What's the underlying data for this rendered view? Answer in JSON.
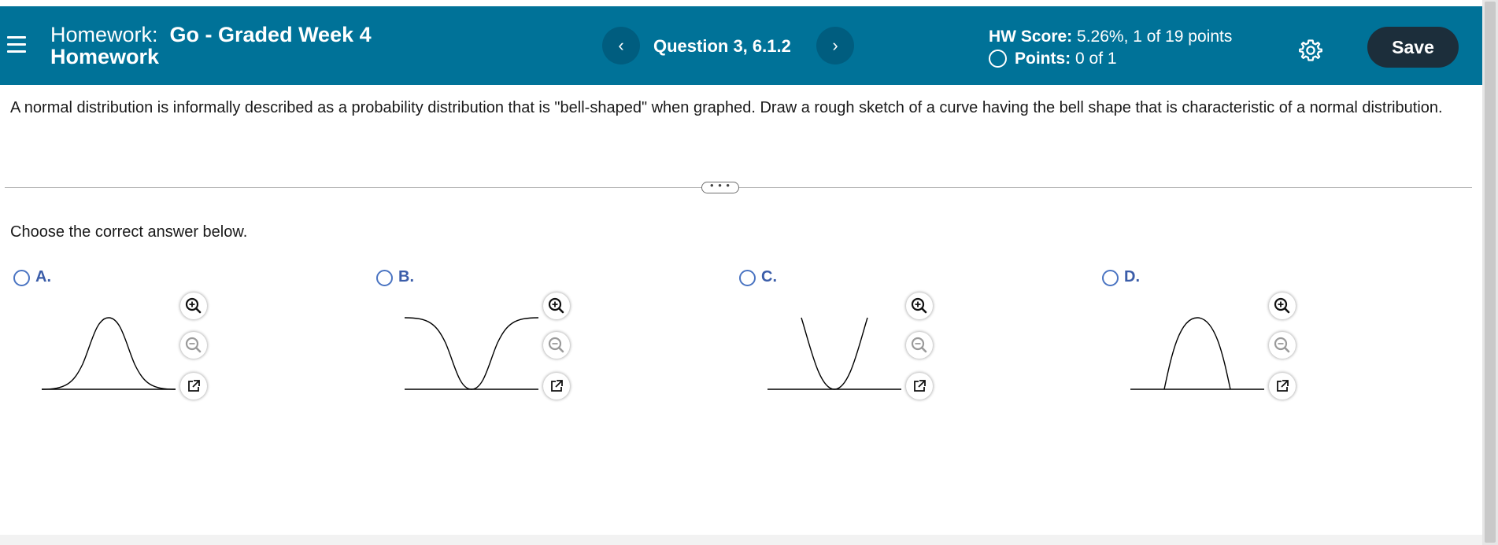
{
  "header": {
    "title_prefix": "Homework:",
    "title_name_line1": "Go - Graded Week 4",
    "title_name_line2": "Homework",
    "prev_symbol": "‹",
    "next_symbol": "›",
    "question_label": "Question 3, 6.1.2",
    "hw_score_label": "HW Score:",
    "hw_score_value": "5.26%, 1 of 19 points",
    "points_label": "Points:",
    "points_value": "0 of 1",
    "save_label": "Save",
    "menu_icon": "hamburger-menu-icon",
    "settings_icon": "gear-icon",
    "header_color": "#007298",
    "save_color": "#1c2e3b"
  },
  "question": {
    "text": "A normal distribution is informally described as a probability distribution that is \"bell-shaped\" when graphed. Draw a rough sketch of a curve having the bell shape that is characteristic of a normal distribution.",
    "expander_label": "• • •",
    "instruction": "Choose the correct answer below."
  },
  "options": [
    {
      "label": "A.",
      "shape": "bell-curve-icon"
    },
    {
      "label": "B.",
      "shape": "inverted-bell-curve-icon"
    },
    {
      "label": "C.",
      "shape": "u-curve-icon"
    },
    {
      "label": "D.",
      "shape": "narrow-hump-curve-icon"
    }
  ],
  "option_tools": [
    "zoom-in-icon",
    "zoom-out-icon",
    "open-external-icon"
  ],
  "accent_color": "#3b5da9"
}
